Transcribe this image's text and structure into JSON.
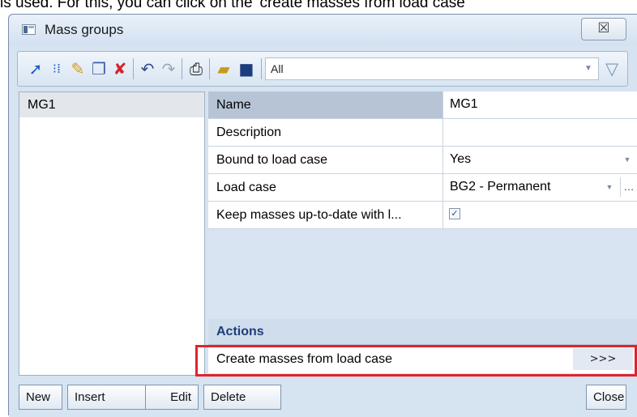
{
  "caption": "is used. For this, you can click on the 'create masses from load case'",
  "window": {
    "title": "Mass groups",
    "close_glyph": "☒"
  },
  "toolbar": {
    "icons": [
      "new-item-icon",
      "insert-icon",
      "edit-icon",
      "copy-icon",
      "delete-icon",
      "undo-icon",
      "redo-icon",
      "print-icon",
      "open-icon",
      "save-icon"
    ],
    "filter_value": "All"
  },
  "list": {
    "items": [
      "MG1"
    ]
  },
  "properties": [
    {
      "name": "Name",
      "value": "MG1"
    },
    {
      "name": "Description",
      "value": ""
    },
    {
      "name": "Bound to load case",
      "value": "Yes"
    },
    {
      "name": "Load case",
      "value": "BG2 - Permanent"
    },
    {
      "name": "Keep masses up-to-date with l...",
      "value": "",
      "checked": true
    }
  ],
  "actions": {
    "header": "Actions",
    "items": [
      {
        "label": "Create masses from load case",
        "button": ">>>"
      }
    ]
  },
  "buttons": {
    "new": "New",
    "insert": "Insert",
    "edit": "Edit",
    "delete": "Delete",
    "close": "Close"
  },
  "colors": {
    "window_bg": "#d6e3f1",
    "actions_header_text": "#1e3e78",
    "highlight": "#e0242c",
    "selected_row": "#b6c4d6"
  }
}
